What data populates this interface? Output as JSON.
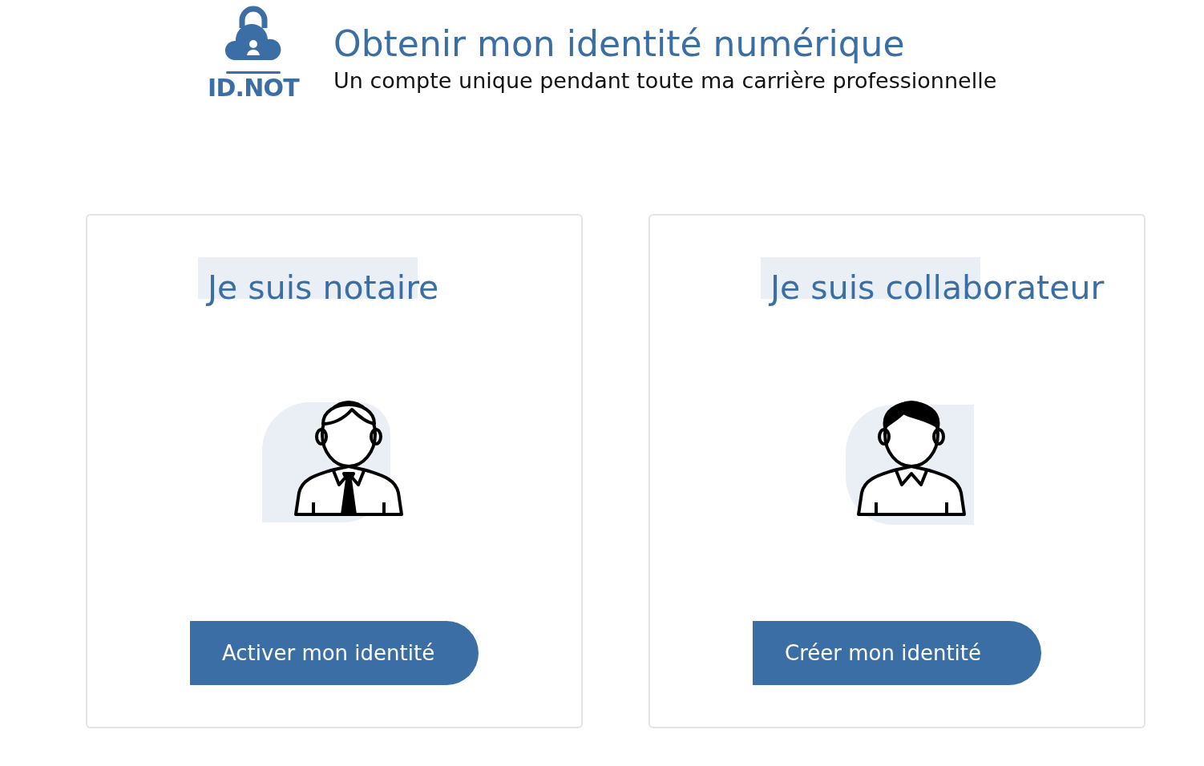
{
  "header": {
    "logo_text": "ID.NOT",
    "title": "Obtenir mon identité numérique",
    "subtitle": "Un compte unique pendant toute ma carrière professionnelle"
  },
  "cards": [
    {
      "heading": "Je suis notaire",
      "kind": "tie",
      "button": "Activer mon identité"
    },
    {
      "heading": "Je suis collaborateur",
      "kind": "plain",
      "button": "Créer mon identité"
    }
  ]
}
